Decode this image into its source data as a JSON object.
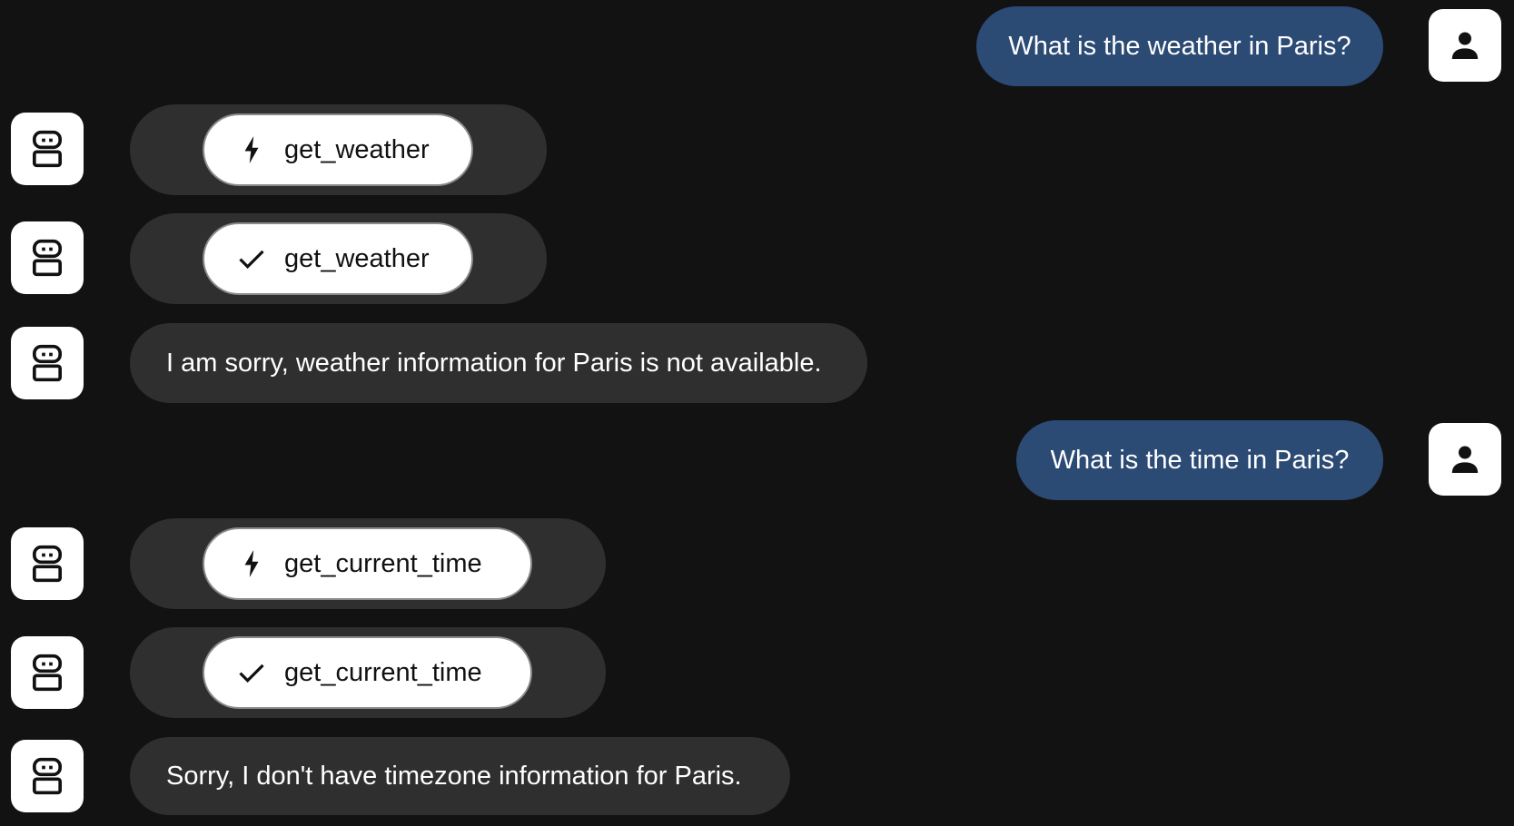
{
  "messages": [
    {
      "role": "user",
      "text": "What is the weather in Paris?"
    },
    {
      "role": "tool_call",
      "status": "calling",
      "status_icon": "lightning-icon",
      "name": "get_weather"
    },
    {
      "role": "tool_call",
      "status": "done",
      "status_icon": "check-icon",
      "name": "get_weather"
    },
    {
      "role": "assistant",
      "text": "I am sorry, weather information for Paris is not available."
    },
    {
      "role": "user",
      "text": "What is the time in Paris?"
    },
    {
      "role": "tool_call",
      "status": "calling",
      "status_icon": "lightning-icon",
      "name": "get_current_time"
    },
    {
      "role": "tool_call",
      "status": "done",
      "status_icon": "check-icon",
      "name": "get_current_time"
    },
    {
      "role": "assistant",
      "text": "Sorry, I don't have timezone information for Paris."
    }
  ],
  "avatars": {
    "user": "person-icon",
    "assistant": "robot-icon"
  },
  "colors": {
    "background": "#121212",
    "user_bubble": "#2b4a74",
    "assistant_bubble": "#2f2f2f",
    "avatar_bg": "#ffffff",
    "tool_chip_bg": "#ffffff"
  }
}
